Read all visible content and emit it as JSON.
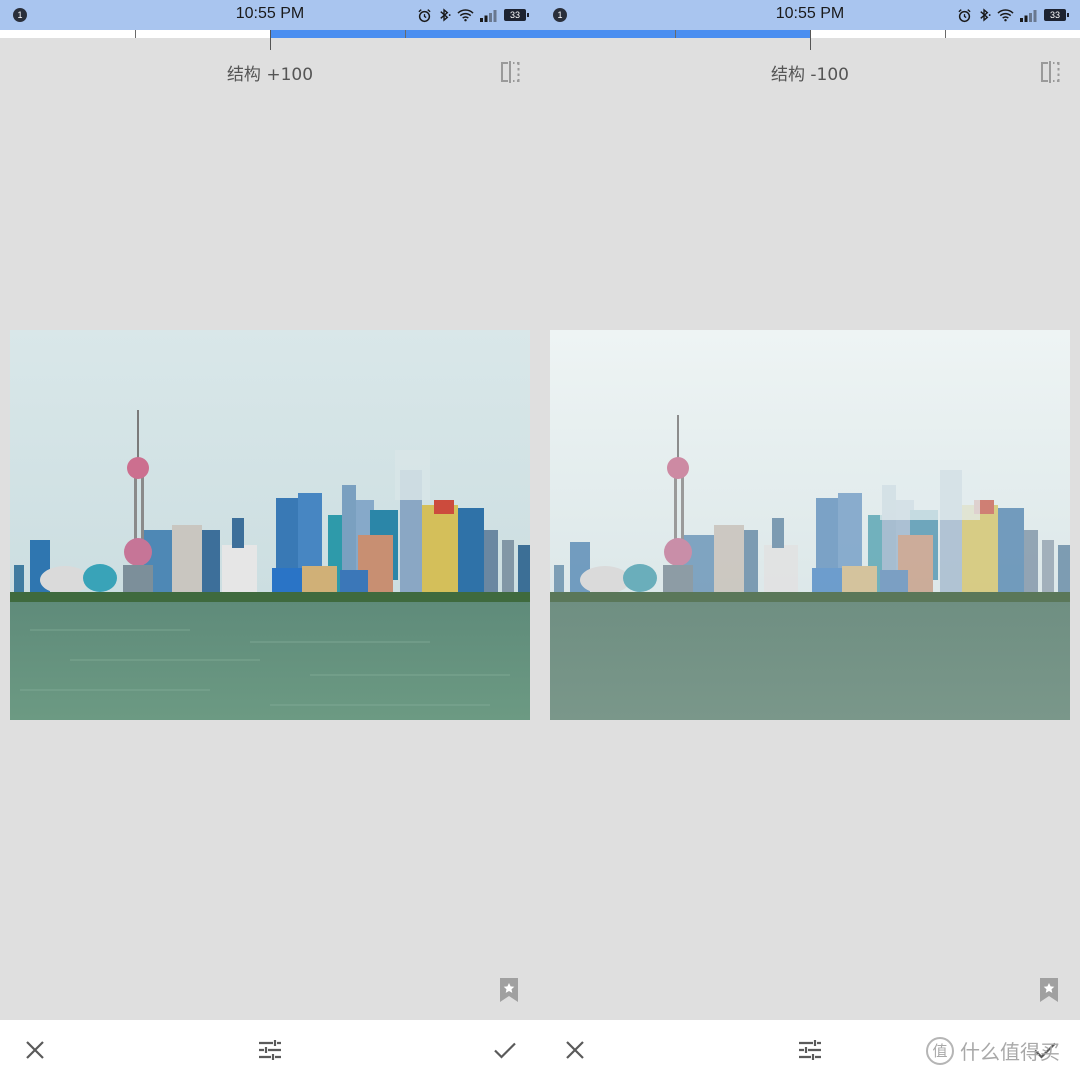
{
  "panels": [
    {
      "status_bar": {
        "notification_count": "1",
        "time": "10:55 PM",
        "battery": "33"
      },
      "adjustment": {
        "name": "结构",
        "value": "+100",
        "slider_fraction": 1.0
      },
      "icons": {
        "compare": "compare-icon",
        "bookmark": "bookmark-star-icon",
        "cancel": "close-icon",
        "tune": "sliders-icon",
        "apply": "check-icon"
      }
    },
    {
      "status_bar": {
        "notification_count": "1",
        "time": "10:55 PM",
        "battery": "33"
      },
      "adjustment": {
        "name": "结构",
        "value": "-100",
        "slider_fraction": 0.0
      },
      "icons": {
        "compare": "compare-icon",
        "bookmark": "bookmark-star-icon",
        "cancel": "close-icon",
        "tune": "sliders-icon",
        "apply": "check-icon"
      }
    }
  ],
  "watermark": {
    "logo_char": "值",
    "text": "什么值得买"
  },
  "colors": {
    "status_bar": "#a9c5ef",
    "slider_accent": "#4a8ef0",
    "background": "#dfdfdf"
  }
}
